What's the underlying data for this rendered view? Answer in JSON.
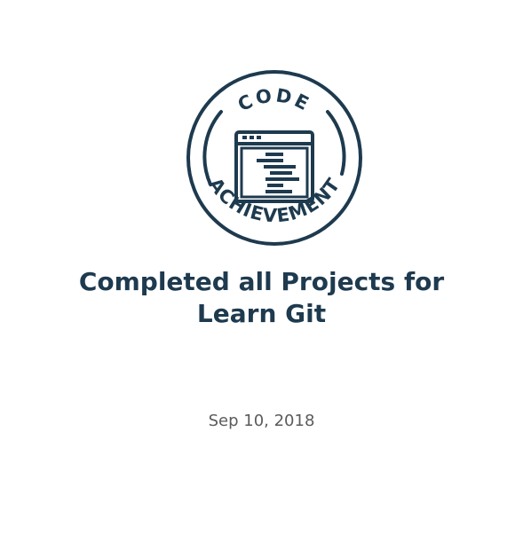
{
  "badge": {
    "top_text": "CODE",
    "bottom_text": "ACHIEVEMENT",
    "icon": "code-window-icon",
    "color": "#1e3a4f"
  },
  "title": {
    "line1": "Completed all Projects for",
    "line2": "Learn Git"
  },
  "date": "Sep 10, 2018"
}
